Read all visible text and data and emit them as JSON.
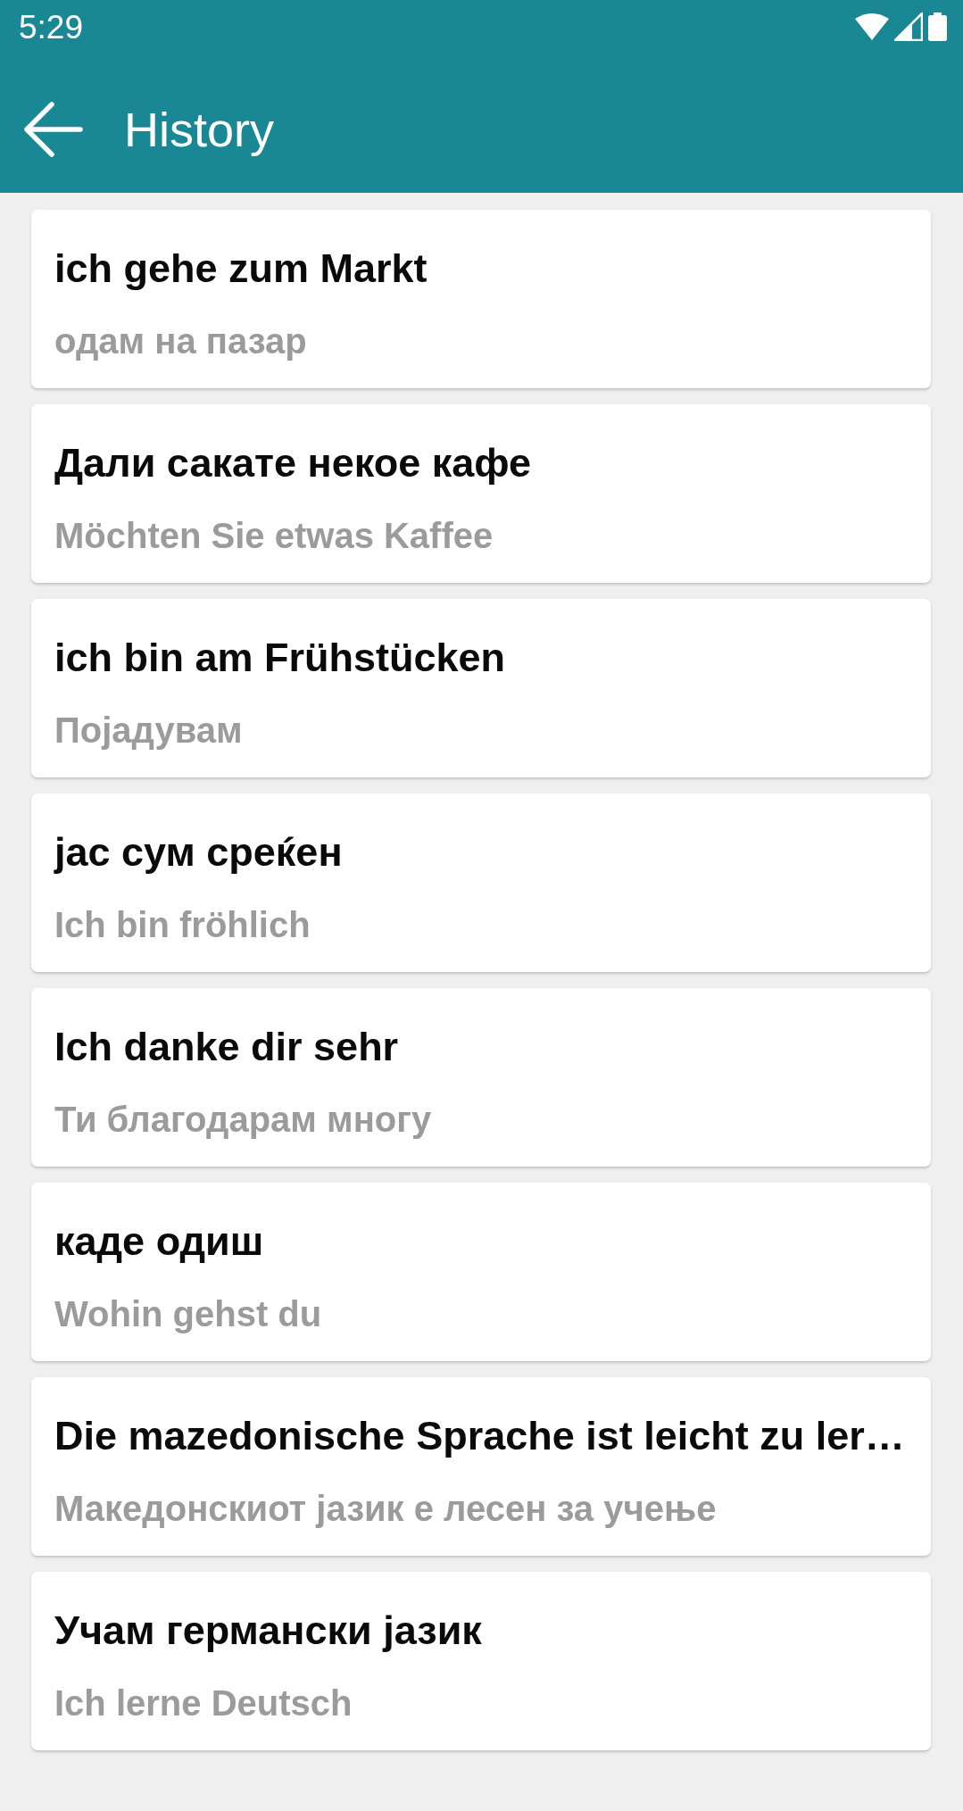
{
  "status_bar": {
    "time": "5:29"
  },
  "app_bar": {
    "title": "History"
  },
  "history": [
    {
      "phrase": "ich gehe zum Markt",
      "translation": "одам на пазар"
    },
    {
      "phrase": "Дали сакате некое кафе",
      "translation": "Möchten Sie etwas Kaffee"
    },
    {
      "phrase": "ich bin am Frühstücken",
      "translation": "Појадувам"
    },
    {
      "phrase": "јас сум среќен",
      "translation": "Ich bin fröhlich"
    },
    {
      "phrase": "Ich danke dir sehr",
      "translation": "Ти благодарам многу"
    },
    {
      "phrase": "каде одиш",
      "translation": "Wohin gehst du"
    },
    {
      "phrase": "Die mazedonische Sprache ist leicht zu ler…",
      "translation": "Македонскиот јазик е лесен за учење"
    },
    {
      "phrase": "Учам германски јазик",
      "translation": "Ich lerne Deutsch"
    }
  ]
}
